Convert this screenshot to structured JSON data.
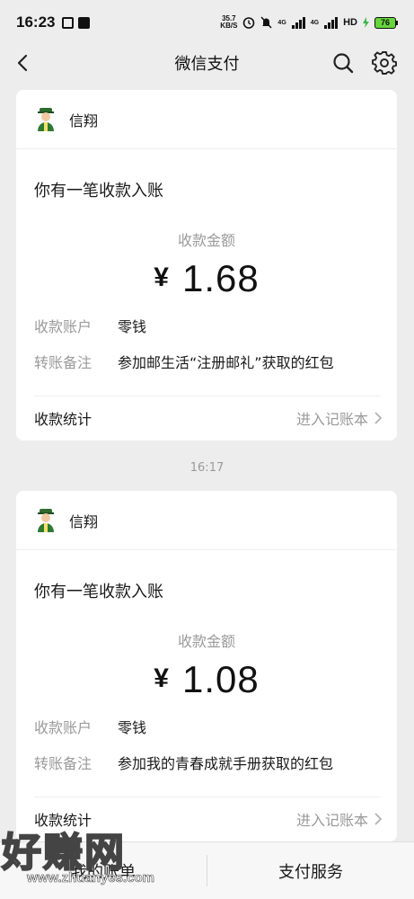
{
  "status_bar": {
    "time": "16:23",
    "net_speed_value": "35.7",
    "net_speed_unit": "KB/S",
    "network_1": "4G",
    "network_2": "4G",
    "hd_label": "HD",
    "battery_level": "76"
  },
  "nav": {
    "title": "微信支付"
  },
  "messages": [
    {
      "sender": "信翔",
      "notice": "你有一笔收款入账",
      "amount_label": "收款金额",
      "currency": "¥",
      "amount": "1.68",
      "account_key": "收款账户",
      "account_value": "零钱",
      "note_key": "转账备注",
      "note_value": "参加邮生活“注册邮礼”获取的红包",
      "stat_label": "收款统计",
      "stat_link": "进入记账本"
    },
    {
      "sender": "信翔",
      "notice": "你有一笔收款入账",
      "amount_label": "收款金额",
      "currency": "¥",
      "amount": "1.08",
      "account_key": "收款账户",
      "account_value": "零钱",
      "note_key": "转账备注",
      "note_value": "参加我的青春成就手册获取的红包",
      "stat_label": "收款统计",
      "stat_link": "进入记账本"
    }
  ],
  "timestamp": "16:17",
  "bottom_bar": {
    "tab_1": "我的账单",
    "tab_2": "支付服务"
  },
  "watermark": {
    "big": "好赚网",
    "small": "www.zhuanyes.com"
  },
  "colors": {
    "background": "#ededed",
    "card": "#ffffff",
    "muted_text": "#9a9a9a",
    "battery": "#67d53d"
  }
}
